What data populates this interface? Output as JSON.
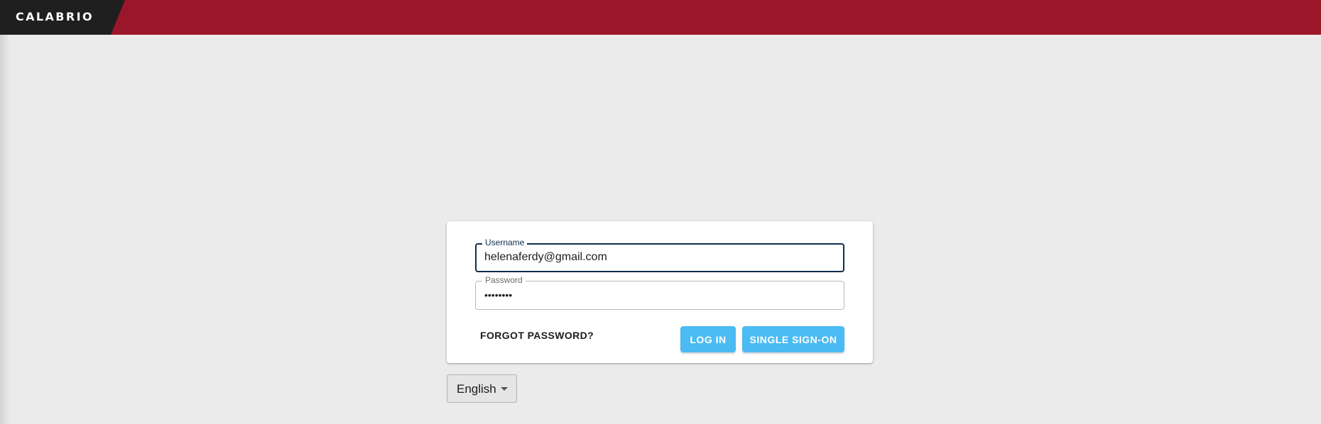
{
  "header": {
    "brand": "CALABRIO",
    "brand_color": "#9b1629",
    "logo_bg": "#1f1f1f"
  },
  "login": {
    "username": {
      "label": "Username",
      "value": "helenaferdy@gmail.com"
    },
    "password": {
      "label": "Password",
      "value": "••••••••"
    },
    "forgot_label": "FORGOT PASSWORD?",
    "login_label": "LOG IN",
    "sso_label": "SINGLE SIGN-ON",
    "button_color": "#4bbbf4"
  },
  "language": {
    "selected": "English",
    "icon": "chevron-down-icon"
  }
}
